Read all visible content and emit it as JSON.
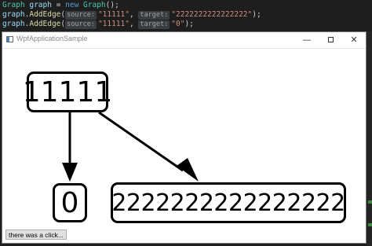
{
  "editor": {
    "lines": [
      {
        "type": "Graph",
        "var": "graph",
        "eq": " = ",
        "kw": "new",
        "ctor": "Graph",
        "tail": "();"
      },
      {
        "obj": "graph",
        "method": "AddEdge",
        "hint_source": "source:",
        "source": "\"11111\"",
        "hint_target": "target:",
        "target": "\"2222222222222222\"",
        "tail": ");"
      },
      {
        "obj": "graph",
        "method": "AddEdge",
        "hint_source": "source:",
        "source": "\"11111\"",
        "hint_target": "target:",
        "target": "\"0\"",
        "tail": ");"
      }
    ],
    "colors": {
      "type": "#4ec9b0",
      "keyword": "#569cd6",
      "string": "#ce9178",
      "method": "#dcdcaa",
      "variable": "#9cdcfe"
    }
  },
  "window": {
    "title": "WpfApplicationSample",
    "controls": {
      "minimize": "—",
      "close": "✕"
    },
    "graph": {
      "nodes": {
        "source": "11111",
        "target_zero": "0",
        "target_long": "2222222222222222"
      },
      "edges": [
        {
          "from": "11111",
          "to": "0"
        },
        {
          "from": "11111",
          "to": "2222222222222222"
        }
      ]
    },
    "status_button_label": "there was a click..."
  }
}
